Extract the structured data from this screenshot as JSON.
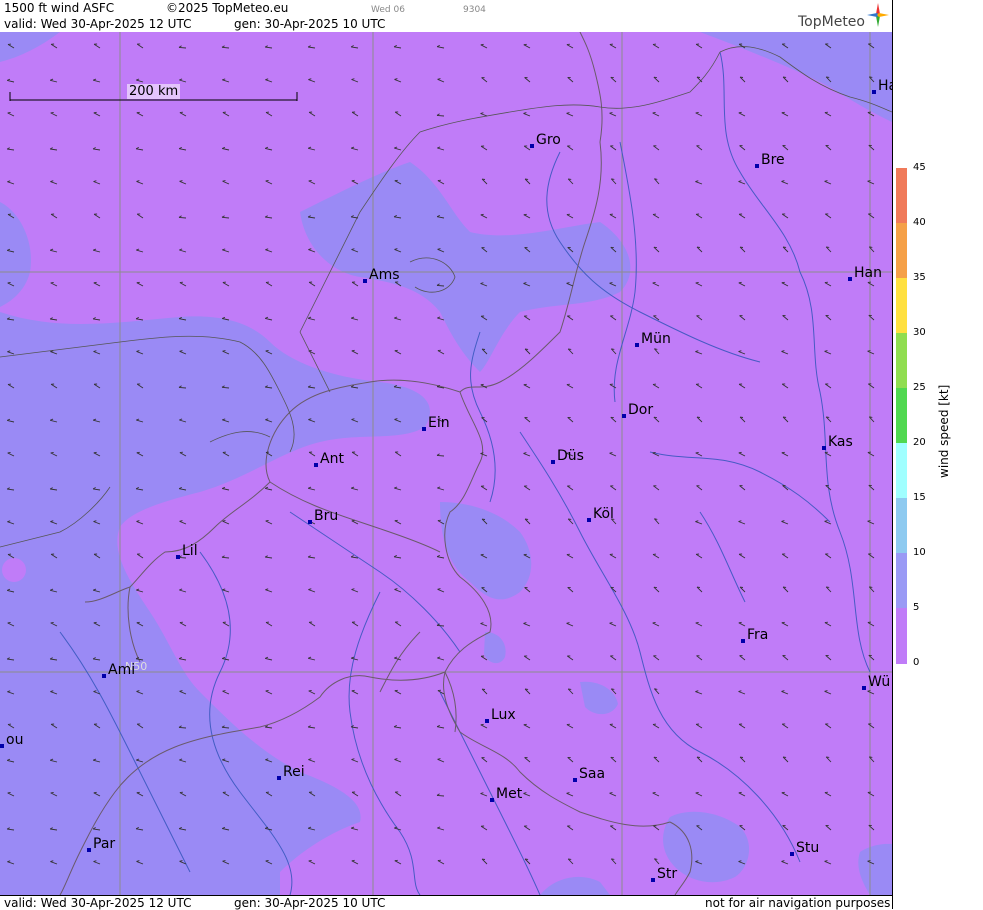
{
  "header": {
    "title": "1500 ft wind ASFC",
    "copyright": "©2025 TopMeteo.eu",
    "day_small": "Wed 06",
    "code_small": "9304",
    "valid": "valid:  Wed  30-Apr-2025  12 UTC",
    "gen": "gen: 30-Apr-2025 10 UTC",
    "logo": "TopMeteo"
  },
  "footer": {
    "valid": "valid:  Wed  30-Apr-2025  12 UTC",
    "gen": "gen: 30-Apr-2025 10 UTC",
    "disclaimer": "not for air navigation purposes"
  },
  "scale": {
    "label": "200 km"
  },
  "grid_label": "N50",
  "colorbar": {
    "title": "wind  speed  [kt]",
    "ticks": [
      "45",
      "40",
      "35",
      "30",
      "25",
      "20",
      "15",
      "10",
      "5",
      "0"
    ],
    "colors": [
      "#f07a5a",
      "#f5a048",
      "#ffe040",
      "#90dd50",
      "#50d850",
      "#a0ffff",
      "#8ecaf0",
      "#9a9af5",
      "#c07cf8"
    ]
  },
  "cities": [
    {
      "name": "Gro"
    },
    {
      "name": "Bre"
    },
    {
      "name": "Ha"
    },
    {
      "name": "Ams"
    },
    {
      "name": "Han"
    },
    {
      "name": "Mün"
    },
    {
      "name": "Ein"
    },
    {
      "name": "Dor"
    },
    {
      "name": "Ant"
    },
    {
      "name": "Düs"
    },
    {
      "name": "Kas"
    },
    {
      "name": "Bru"
    },
    {
      "name": "Köl"
    },
    {
      "name": "Lil"
    },
    {
      "name": "Ami"
    },
    {
      "name": "Fra"
    },
    {
      "name": "Wü"
    },
    {
      "name": "ou"
    },
    {
      "name": "Lux"
    },
    {
      "name": "Rei"
    },
    {
      "name": "Saa"
    },
    {
      "name": "Met"
    },
    {
      "name": "Par"
    },
    {
      "name": "Stu"
    },
    {
      "name": "Str"
    }
  ]
}
